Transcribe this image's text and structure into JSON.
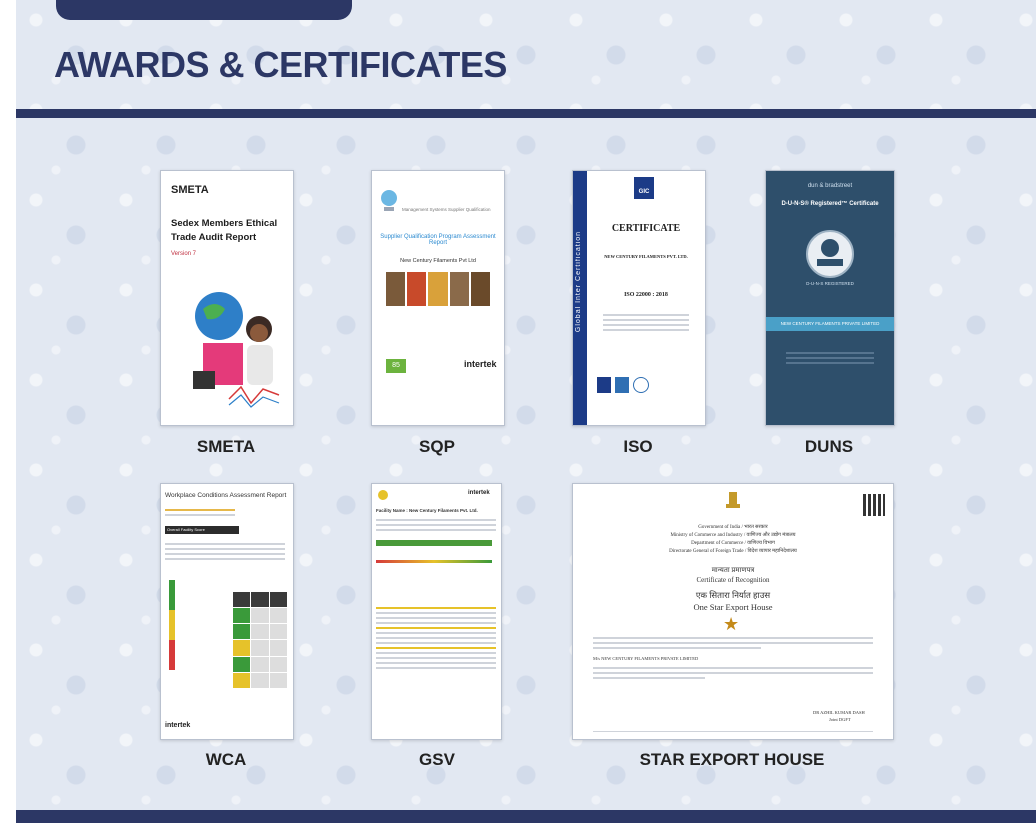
{
  "page": {
    "title": "AWARDS & CERTIFICATES"
  },
  "certificates": [
    {
      "label": "SMETA",
      "doc": {
        "logo": "SMETA",
        "title": "Sedex Members Ethical Trade Audit Report",
        "version": "Version 7"
      }
    },
    {
      "label": "SQP",
      "doc": {
        "title": "Supplier Qualification Program Assessment Report",
        "company": "New Century Filaments Pvt Ltd",
        "score": "85",
        "brand": "intertek"
      }
    },
    {
      "label": "ISO",
      "doc": {
        "side_text": "Global Inter Certification",
        "logo": "GIC",
        "title": "CERTIFICATE",
        "company": "NEW CENTURY FILAMENTS PVT. LTD.",
        "standard": "ISO 22000 : 2018"
      }
    },
    {
      "label": "DUNS",
      "doc": {
        "brand": "dun & bradstreet",
        "title": "D-U-N-S® Registered™ Certificate",
        "seal": "D-U-N-S REGISTERED",
        "company": "NEW CENTURY FILAMENTS PRIVATE LIMITED"
      }
    },
    {
      "label": "WCA",
      "doc": {
        "title": "Workplace Conditions Assessment Report",
        "score_label": "Overall Facility Score",
        "brand": "intertek"
      }
    },
    {
      "label": "GSV",
      "doc": {
        "facility": "Facility Name : New Century Filaments Pvt. Ltd.",
        "score_label": "OVERALL FACILITY SCORE",
        "brand": "intertek"
      }
    },
    {
      "label": "STAR EXPORT HOUSE",
      "doc": {
        "gov_line1": "Government of India / भारत सरकार",
        "gov_line2": "Ministry of Commerce and Industry / वाणिज्य और उद्योग मंत्रालय",
        "gov_line3": "Department of Commerce / वाणिज्य विभाग",
        "gov_line4": "Directorate General of Foreign Trade / विदेश व्यापार महानिदेशालय",
        "cert_hi": "मान्यता प्रमाणपत्र",
        "cert_en": "Certificate of Recognition",
        "status_hi": "एक सितारा निर्यात हाउस",
        "status_en": "One Star Export House",
        "company": "M/s NEW CENTURY FILAMENTS PRIVATE LIMITED",
        "signatory": "DR AZHIL KUMAR DASH",
        "signatory_title": "Joint DGFT"
      }
    }
  ],
  "colors": {
    "navy": "#2c3765",
    "background": "#e2e8f2"
  }
}
